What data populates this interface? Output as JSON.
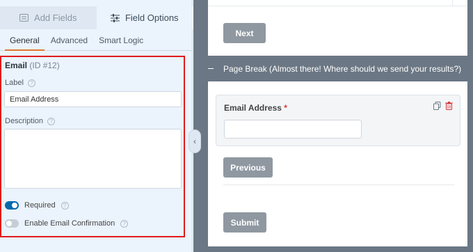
{
  "left_panel": {
    "tabs": [
      {
        "label": "Add Fields",
        "icon": "list-icon",
        "active": false
      },
      {
        "label": "Field Options",
        "icon": "sliders-icon",
        "active": true
      }
    ],
    "sub_tabs": [
      {
        "label": "General",
        "active": true
      },
      {
        "label": "Advanced",
        "active": false
      },
      {
        "label": "Smart Logic",
        "active": false
      }
    ],
    "field_options": {
      "field_name": "Email",
      "field_id": "(ID #12)",
      "label_caption": "Label",
      "label_value": "Email Address",
      "description_caption": "Description",
      "description_value": "",
      "required_label": "Required",
      "required_on": true,
      "email_confirmation_label": "Enable Email Confirmation",
      "email_confirmation_on": false
    },
    "highlight_color": "#e01b1b",
    "accent_color": "#e27730",
    "toggle_color": "#036aab"
  },
  "preview": {
    "next_label": "Next",
    "page_break_text": "Page Break (Almost there! Where should we send your results?)",
    "email_field": {
      "label": "Email Address",
      "required_mark": "*"
    },
    "previous_label": "Previous",
    "submit_label": "Submit"
  }
}
